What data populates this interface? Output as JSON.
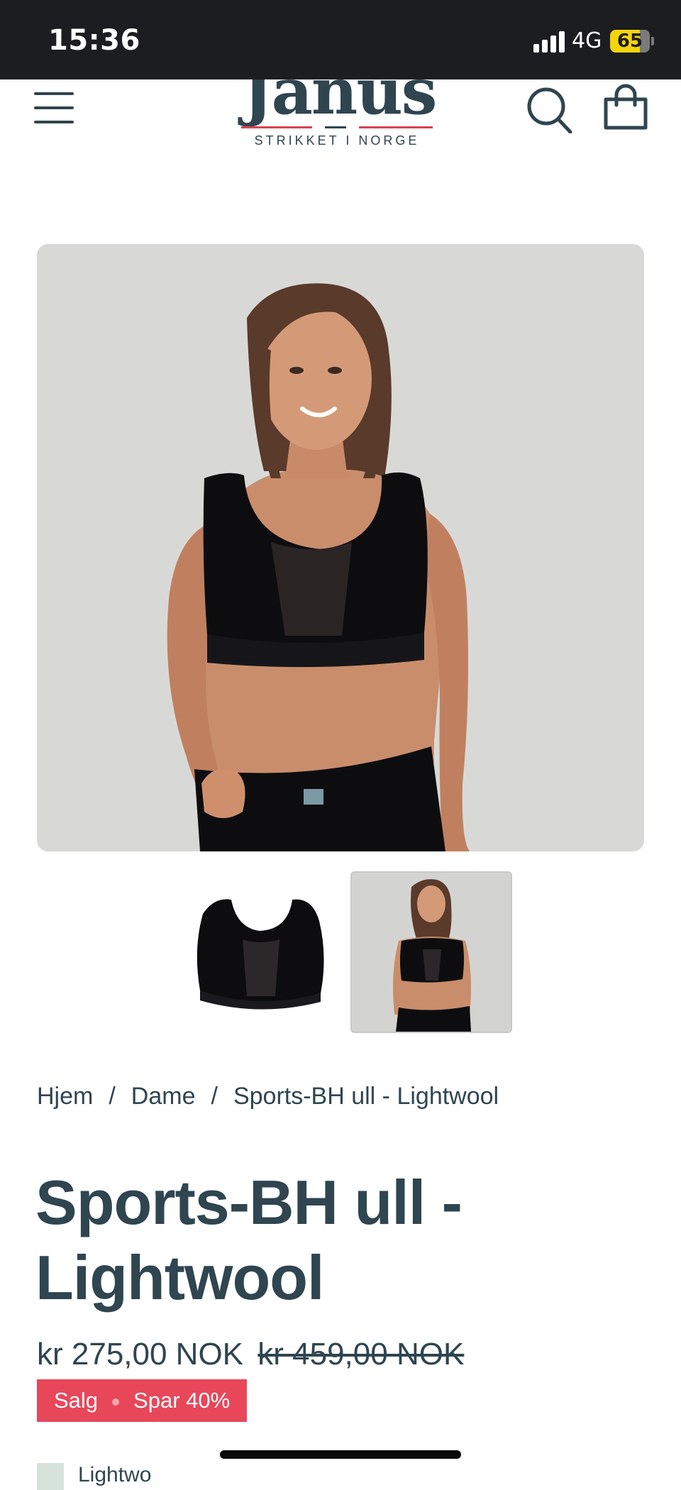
{
  "status_bar": {
    "time": "15:36",
    "network": "4G",
    "battery": "65"
  },
  "header": {
    "logo_word": "Janus",
    "logo_tagline": "STRIKKET I NORGE",
    "menu_icon": "hamburger-menu-icon",
    "search_icon": "search-icon",
    "cart_icon": "shopping-bag-icon"
  },
  "breadcrumb": {
    "items": [
      "Hjem",
      "Dame",
      "Sports-BH ull - Lightwool"
    ],
    "separator": "/"
  },
  "product": {
    "title": "Sports-BH ull - Lightwool",
    "price": "kr 275,00 NOK",
    "compare_price": "kr 459,00 NOK",
    "badge_sale": "Salg",
    "badge_save": "Spar 40%",
    "variant_label": "Lightwo"
  },
  "colors": {
    "text": "#2f4550",
    "sale_badge": "#e8475a",
    "status_bar": "#1c1d21",
    "battery": "#f5d40c",
    "logo_red": "#d9434f",
    "swatch": "#d6e3da"
  }
}
